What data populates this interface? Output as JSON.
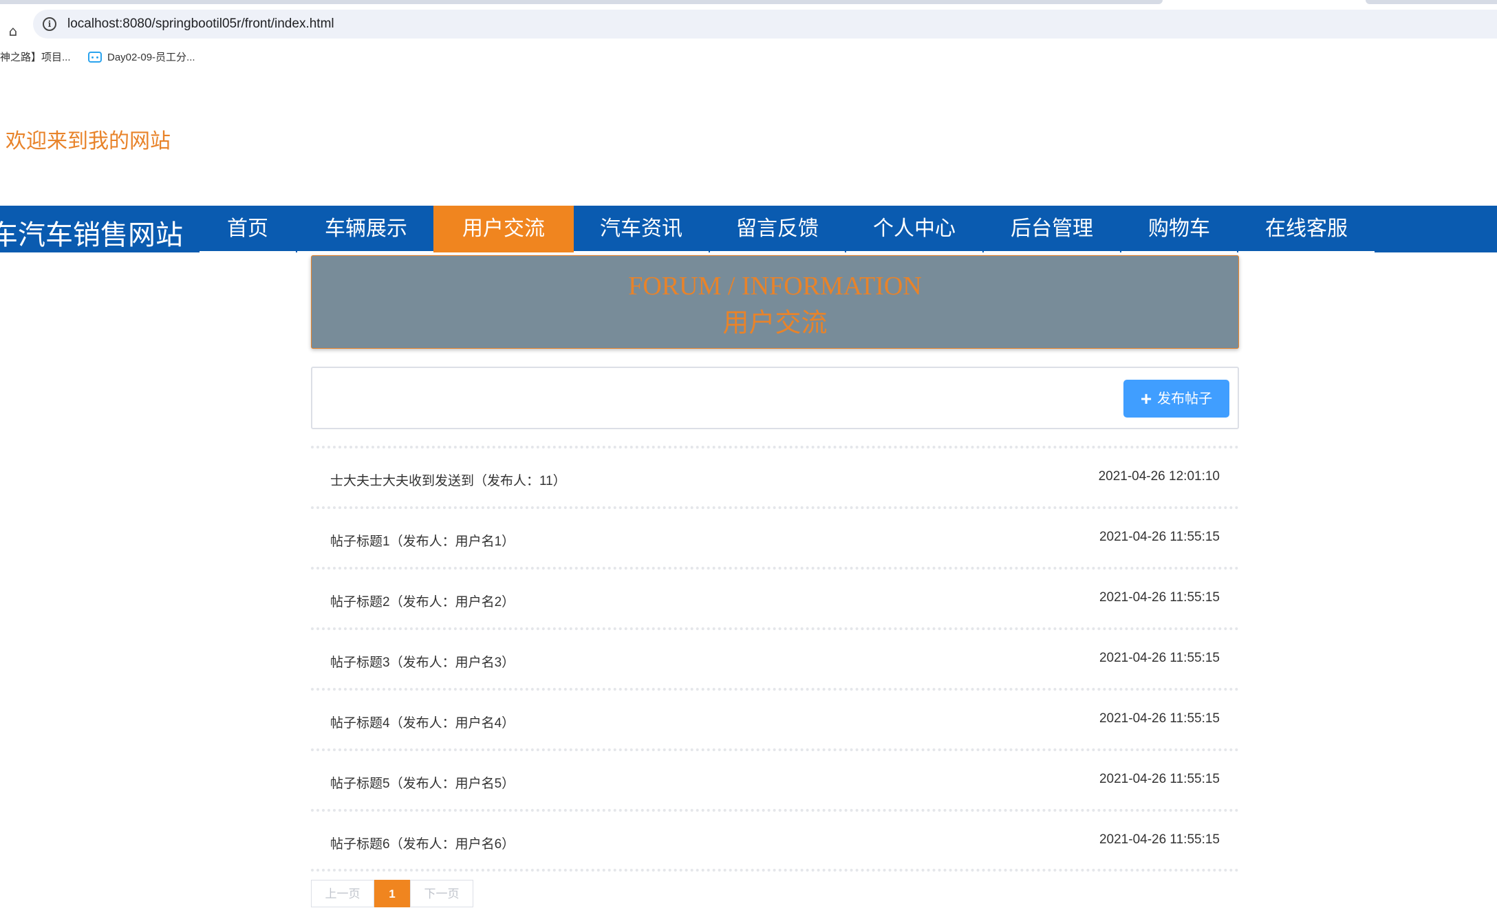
{
  "browser": {
    "url": "localhost:8080/springbootil05r/front/index.html",
    "bookmarks": [
      {
        "label": "神之路】项目..."
      },
      {
        "label": "Day02-09-员工分..."
      }
    ]
  },
  "page": {
    "welcome": "欢迎来到我的网站",
    "brand": "车汽车销售网站",
    "nav": [
      {
        "label": "首页",
        "active": false
      },
      {
        "label": "车辆展示",
        "active": false
      },
      {
        "label": "用户交流",
        "active": true
      },
      {
        "label": "汽车资讯",
        "active": false
      },
      {
        "label": "留言反馈",
        "active": false
      },
      {
        "label": "个人中心",
        "active": false
      },
      {
        "label": "后台管理",
        "active": false
      },
      {
        "label": "购物车",
        "active": false
      },
      {
        "label": "在线客服",
        "active": false
      }
    ],
    "banner": {
      "en": "FORUM / INFORMATION",
      "cn": "用户交流"
    },
    "publish_button": "发布帖子",
    "posts": [
      {
        "title": "士大夫士大夫收到发送到（发布人：11）",
        "time": "2021-04-26 12:01:10"
      },
      {
        "title": "帖子标题1（发布人：用户名1）",
        "time": "2021-04-26 11:55:15"
      },
      {
        "title": "帖子标题2（发布人：用户名2）",
        "time": "2021-04-26 11:55:15"
      },
      {
        "title": "帖子标题3（发布人：用户名3）",
        "time": "2021-04-26 11:55:15"
      },
      {
        "title": "帖子标题4（发布人：用户名4）",
        "time": "2021-04-26 11:55:15"
      },
      {
        "title": "帖子标题5（发布人：用户名5）",
        "time": "2021-04-26 11:55:15"
      },
      {
        "title": "帖子标题6（发布人：用户名6）",
        "time": "2021-04-26 11:55:15"
      }
    ],
    "pager": {
      "prev": "上一页",
      "current": "1",
      "next": "下一页"
    }
  },
  "colors": {
    "nav_bg": "#0a5bb0",
    "accent": "#f0851f",
    "banner_bg": "#788c99",
    "button_blue": "#409eff"
  }
}
